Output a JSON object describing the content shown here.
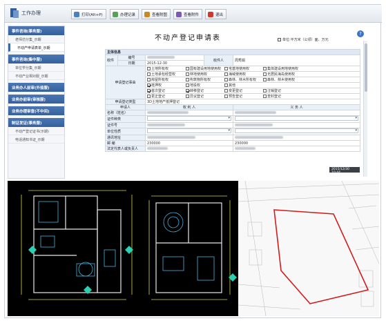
{
  "app": {
    "title": "工作办理"
  },
  "toolbar": {
    "buttons": [
      {
        "label": "打印(Alt+P)",
        "color": "#4a7fc1"
      },
      {
        "label": "办理记录",
        "color": "#5aa05a"
      },
      {
        "label": "查看附图",
        "color": "#c48a2a"
      },
      {
        "label": "查看附件",
        "color": "#7a5ab5"
      },
      {
        "label": "退出",
        "color": "#d03a2e"
      }
    ]
  },
  "sidebar": {
    "sections": [
      {
        "label": "事件咨询(事务服)",
        "items": [
          "老师仿分集_示期",
          "不动产申请表单_示期"
        ]
      },
      {
        "label": "事件咨询(集中服)",
        "items": [
          "单位学分集_示期",
          "不动产业相对服_示期"
        ]
      },
      {
        "label": "业务办人前审(外接服)",
        "items": []
      },
      {
        "label": "业务办前审(审核服)",
        "items": []
      },
      {
        "label": "业务办理审查(不中间)",
        "items": []
      },
      {
        "label": "制证发证(事务服)",
        "items": [
          "不动产登记证书(示期)",
          "电话通知书证_示期"
        ]
      }
    ],
    "active_item": "不动产申请表单_示期"
  },
  "form": {
    "title": "不动产登记申请表",
    "unit_note": "单位:平方米（公顷）面、万元",
    "help": "?",
    "section_main": "主体信息",
    "收件": "收件",
    "编号_label": "编号",
    "日期_label": "日期",
    "日期_value": "2015-12-30",
    "收件人_label": "收件人",
    "收件人_value": "周秀娟",
    "申请登记事由": "申请登记事由",
    "rights": [
      [
        "土地所有权",
        "国有建设用地使用权",
        "宅基地使用权",
        "集体建设用地使用权"
      ],
      [
        "土地承包经营权",
        "林地使用权",
        "海域使用权",
        "无居民海岛使用权"
      ],
      [
        "房屋所有权",
        "构筑物所有权",
        "森林、林木所有权",
        "森林、林木使用权"
      ],
      [
        "抵押权",
        "地役权",
        "其他"
      ]
    ],
    "rights_checked": [
      "抵押权"
    ],
    "reg_types": [
      [
        "首次登记",
        "转移登记",
        "变更登记",
        "注销登记"
      ],
      [
        "更正登记",
        "异议登记",
        "预告登记",
        "查封登记"
      ]
    ],
    "reg_checked": [
      "首次登记",
      "转移登记"
    ],
    "申请登记类型_label": "申请登记类型",
    "申请登记类型_value": "3D土地地产抵押登记",
    "申请人_label": "申请人",
    "权利人": "权 利 人",
    "义务人": "义 务 人",
    "fields": [
      "名称（姓名）",
      "证件种类",
      "证件号",
      "单位性质",
      "通讯地址",
      "邮 编",
      "法定代表人或负责人"
    ],
    "postal_a": "230000",
    "postal_b": "230000",
    "datetag": "2015/12/30 10:44"
  }
}
